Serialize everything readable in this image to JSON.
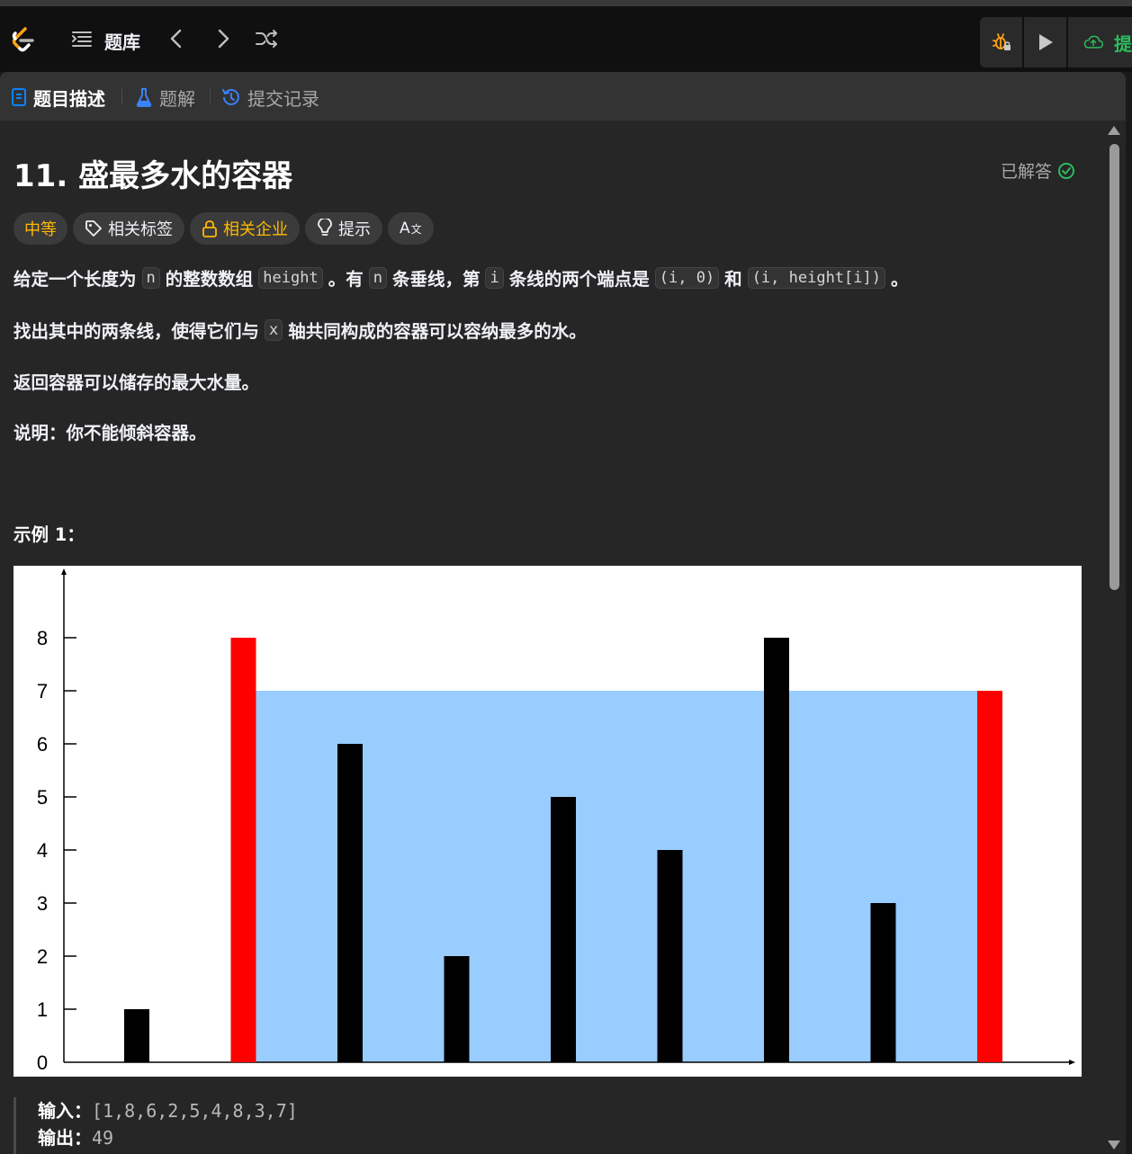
{
  "colors": {
    "accent_blue": "#0a84ff",
    "medium": "#ffb800",
    "solved_green": "#2cbb5d",
    "chart_water": "#99ccff",
    "chart_bar": "#000000",
    "chart_highlight": "#ff0000"
  },
  "topbar": {
    "logo": "leetcode-logo",
    "problem_list_label": "题库",
    "icons": [
      "list-icon",
      "chevron-left-icon",
      "chevron-right-icon",
      "shuffle-icon",
      "debug-icon",
      "play-icon",
      "cloud-upload-icon"
    ],
    "submit_label_partial": "提"
  },
  "tabs": [
    {
      "label": "题目描述",
      "icon": "description-icon",
      "active": true
    },
    {
      "label": "题解",
      "icon": "flask-icon",
      "active": false
    },
    {
      "label": "提交记录",
      "icon": "history-icon",
      "active": false
    }
  ],
  "problem": {
    "title": "11. 盛最多水的容器",
    "status": "已解答",
    "tags": {
      "difficulty": "中等",
      "topics": "相关标签",
      "companies": "相关企业",
      "hints": "提示",
      "translate": "A"
    },
    "desc1": {
      "t1": "给定一个长度为",
      "c1": "n",
      "t2": "的整数数组",
      "c2": "height",
      "t3": "。有",
      "c3": "n",
      "t4": "条垂线，第",
      "c4": "i",
      "t5": "条线的两个端点是",
      "c5": "(i, 0)",
      "t6": "和",
      "c6": "(i, height[i])",
      "t7": "。"
    },
    "desc2": {
      "t1": "找出其中的两条线，使得它们与",
      "c1": "x",
      "t2": "轴共同构成的容器可以容纳最多的水。"
    },
    "desc3": "返回容器可以储存的最大水量。",
    "note_label": "说明：",
    "note_text": "你不能倾斜容器。",
    "example_title": "示例 1：",
    "example": {
      "input_label": "输入：",
      "input_value": "[1,8,6,2,5,4,8,3,7]",
      "output_label": "输出：",
      "output_value": "49"
    }
  },
  "chart_data": {
    "type": "bar",
    "categories": [
      "0",
      "1",
      "2",
      "3",
      "4",
      "5",
      "6",
      "7",
      "8"
    ],
    "values": [
      1,
      8,
      6,
      2,
      5,
      4,
      8,
      3,
      7
    ],
    "highlighted_indices": [
      1,
      8
    ],
    "water_level": 7,
    "water_range": [
      1,
      8
    ],
    "y_ticks": [
      0,
      1,
      2,
      3,
      4,
      5,
      6,
      7,
      8
    ],
    "ylim": [
      0,
      8.9
    ],
    "title": "",
    "xlabel": "",
    "ylabel": "",
    "grid": false
  }
}
